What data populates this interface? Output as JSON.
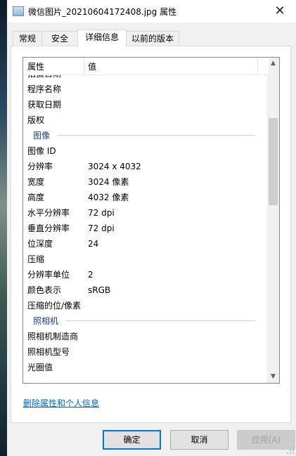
{
  "window": {
    "title": "微信图片_20210604172408.jpg 属性",
    "close_glyph": "✕"
  },
  "tabs": [
    {
      "label": "常规",
      "active": false
    },
    {
      "label": "安全",
      "active": false
    },
    {
      "label": "详细信息",
      "active": true
    },
    {
      "label": "以前的版本",
      "active": false
    }
  ],
  "table": {
    "columns": [
      "属性",
      "值"
    ],
    "partial_top_row": "拍摄日期",
    "rows": [
      {
        "type": "row",
        "name": "程序名称",
        "value": ""
      },
      {
        "type": "row",
        "name": "获取日期",
        "value": ""
      },
      {
        "type": "row",
        "name": "版权",
        "value": ""
      },
      {
        "type": "group",
        "name": "图像"
      },
      {
        "type": "row",
        "name": "图像 ID",
        "value": ""
      },
      {
        "type": "row",
        "name": "分辨率",
        "value": "3024 x 4032"
      },
      {
        "type": "row",
        "name": "宽度",
        "value": "3024 像素"
      },
      {
        "type": "row",
        "name": "高度",
        "value": "4032 像素"
      },
      {
        "type": "row",
        "name": "水平分辨率",
        "value": "72 dpi"
      },
      {
        "type": "row",
        "name": "垂直分辨率",
        "value": "72 dpi"
      },
      {
        "type": "row",
        "name": "位深度",
        "value": "24"
      },
      {
        "type": "row",
        "name": "压缩",
        "value": ""
      },
      {
        "type": "row",
        "name": "分辨率单位",
        "value": "2"
      },
      {
        "type": "row",
        "name": "颜色表示",
        "value": "sRGB"
      },
      {
        "type": "row",
        "name": "压缩的位/像素",
        "value": ""
      },
      {
        "type": "group",
        "name": "照相机"
      },
      {
        "type": "row",
        "name": "照相机制造商",
        "value": ""
      },
      {
        "type": "row",
        "name": "照相机型号",
        "value": ""
      },
      {
        "type": "row",
        "name": "光圈值",
        "value": ""
      }
    ],
    "scroll": {
      "up_icon": "up-arrow-icon",
      "down_icon": "down-arrow-icon",
      "position_fraction": 0.16,
      "visible_fraction": 0.29
    }
  },
  "remove_link": "删除属性和个人信息",
  "buttons": {
    "ok": "确定",
    "cancel": "取消",
    "apply": "应用(A)"
  },
  "colors": {
    "accent": "#0078d7",
    "link": "#0066cc",
    "group_text": "#1e3e8a"
  }
}
